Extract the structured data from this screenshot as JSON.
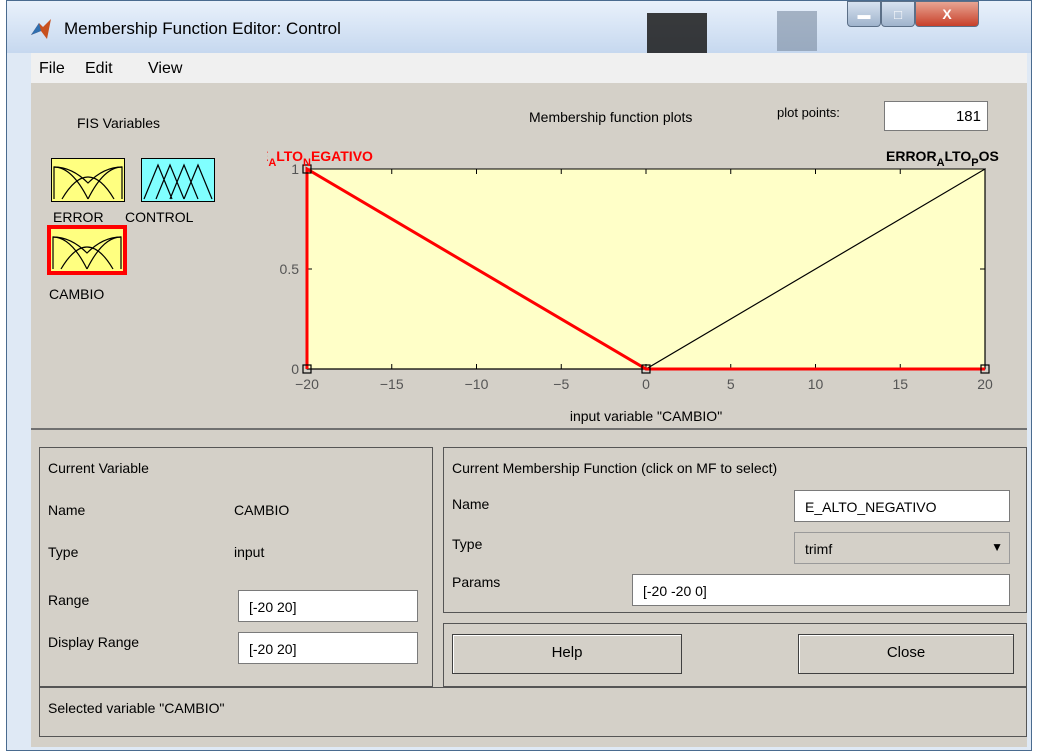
{
  "window": {
    "title": "Membership Function Editor: Control"
  },
  "menu": [
    "File",
    "Edit",
    "View"
  ],
  "fis": {
    "label": "FIS Variables",
    "variables": [
      {
        "name": "ERROR",
        "color": "#ffff80"
      },
      {
        "name": "CONTROL",
        "color": "#80ffff"
      },
      {
        "name": "CAMBIO",
        "color": "#ffff80",
        "selected": true
      }
    ]
  },
  "plot": {
    "title": "Membership function plots",
    "plot_points_label": "plot points:",
    "plot_points_value": "181",
    "xlabel": "input variable \"CAMBIO\"",
    "mf_left_label_parts": [
      "E",
      "A",
      "LTO",
      "N",
      "EGATIVO"
    ],
    "mf_right_label_parts": [
      "ERROR",
      "A",
      "LTO",
      "P",
      "OS"
    ]
  },
  "chart_data": {
    "type": "line",
    "xlim": [
      -20,
      20
    ],
    "ylim": [
      0,
      1
    ],
    "xticks": [
      -20,
      -15,
      -10,
      -5,
      0,
      5,
      10,
      15,
      20
    ],
    "yticks": [
      0,
      0.5,
      1
    ],
    "series": [
      {
        "name": "E_ALTO_NEGATIVO",
        "color": "#ff0000",
        "x": [
          -20,
          -20,
          0,
          20
        ],
        "y": [
          0,
          1,
          0,
          0
        ]
      },
      {
        "name": "ERROR_ALTO_POS",
        "color": "#000000",
        "x": [
          -20,
          0,
          20,
          20
        ],
        "y": [
          0,
          0,
          1,
          0
        ]
      }
    ]
  },
  "current_variable": {
    "header": "Current Variable",
    "name_label": "Name",
    "name_value": "CAMBIO",
    "type_label": "Type",
    "type_value": "input",
    "range_label": "Range",
    "range_value": "[-20 20]",
    "display_range_label": "Display Range",
    "display_range_value": "[-20 20]"
  },
  "current_mf": {
    "header": "Current Membership Function (click on MF to select)",
    "name_label": "Name",
    "name_value": "E_ALTO_NEGATIVO",
    "type_label": "Type",
    "type_value": "trimf",
    "params_label": "Params",
    "params_value": "[-20 -20 0]"
  },
  "buttons": {
    "help": "Help",
    "close": "Close"
  },
  "status": "Selected variable \"CAMBIO\""
}
